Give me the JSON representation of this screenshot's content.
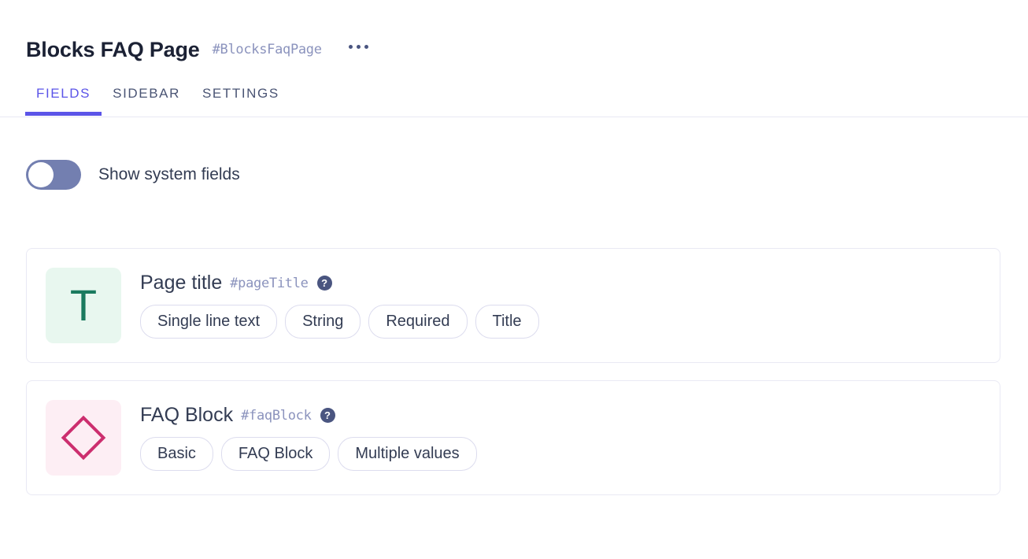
{
  "header": {
    "title": "Blocks FAQ Page",
    "identifier": "#BlocksFaqPage",
    "menu_icon": "kebab-menu-icon"
  },
  "tabs": [
    {
      "label": "FIELDS",
      "active": true
    },
    {
      "label": "SIDEBAR",
      "active": false
    },
    {
      "label": "SETTINGS",
      "active": false
    }
  ],
  "toggle": {
    "label": "Show system fields",
    "state": "off"
  },
  "fields": [
    {
      "name": "Page title",
      "identifier": "#pageTitle",
      "icon": "text-field-icon",
      "icon_glyph": "T",
      "help_icon": "help-icon",
      "tags": [
        "Single line text",
        "String",
        "Required",
        "Title"
      ]
    },
    {
      "name": "FAQ Block",
      "identifier": "#faqBlock",
      "icon": "block-field-icon",
      "icon_glyph": "diamond",
      "help_icon": "help-icon",
      "tags": [
        "Basic",
        "FAQ Block",
        "Multiple values"
      ]
    }
  ],
  "colors": {
    "accent": "#5b54e8",
    "title": "#1b2134",
    "muted": "#8b93bd",
    "toggle_track": "#737fb0",
    "text_icon_bg": "#e8f7ef",
    "text_icon_fg": "#1a7a5e",
    "block_icon_bg": "#fdeef4",
    "block_icon_fg": "#cc2e6e",
    "card_border": "#e9e9f4",
    "tag_border": "#dcdcee"
  },
  "help_glyph": "?"
}
